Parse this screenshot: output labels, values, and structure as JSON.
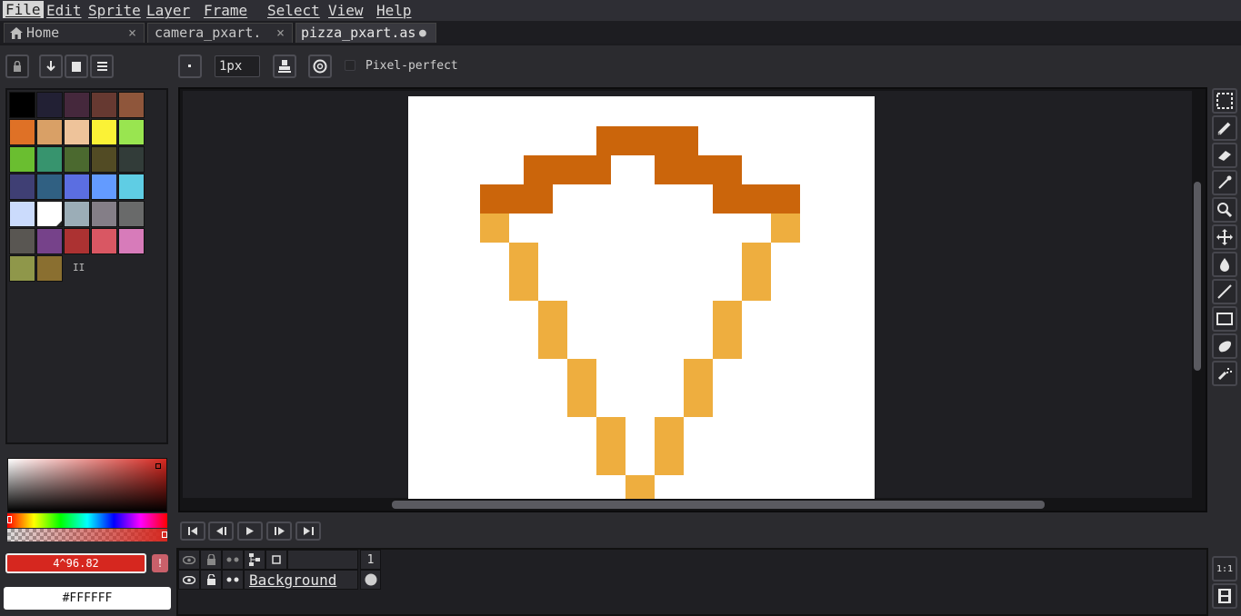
{
  "menu": {
    "items": [
      "File",
      "Edit",
      "Sprite",
      "Layer",
      "Frame",
      "Select",
      "View",
      "Help"
    ]
  },
  "tabs": [
    {
      "label": "Home",
      "icon": "home-icon",
      "close": "×"
    },
    {
      "label": "camera_pxart.",
      "close": "×"
    },
    {
      "label": "pizza_pxart.as",
      "modified_indicator": "●"
    }
  ],
  "toolbar": {
    "brush_size": "1px",
    "pixel_perfect_label": "Pixel-perfect",
    "pixel_perfect_checked": false
  },
  "palette": {
    "colors": [
      "#000000",
      "#222034",
      "#45283c",
      "#663931",
      "#8f563b",
      "#df7126",
      "#d9a066",
      "#eec39a",
      "#fbf236",
      "#99e550",
      "#6abe30",
      "#37946e",
      "#4b692f",
      "#524b24",
      "#323c39",
      "#3f3f74",
      "#306082",
      "#5b6ee1",
      "#639bff",
      "#5fcde4",
      "#cbdbfc",
      "#ffffff",
      "#9badb7",
      "#847e87",
      "#696a6a",
      "#595652",
      "#76428a",
      "#ac3232",
      "#d95763",
      "#d77bba",
      "#8f974a",
      "#8a6f30"
    ],
    "selected_index": 21,
    "resize_handle": "II"
  },
  "color_picker": {
    "foreground_label": "4^96.82",
    "background_label": "#FFFFFF",
    "warning_icon": "exclamation-icon"
  },
  "sprite": {
    "background": "#ffffff",
    "crust_color": "#cb650b",
    "cheese_color": "#eeae3f"
  },
  "timeline": {
    "frame_number": "1",
    "layer_name": "Background"
  },
  "tools": [
    "marquee-icon",
    "pencil-icon",
    "eraser-icon",
    "eyedropper-icon",
    "zoom-icon",
    "move-icon",
    "paint-bucket-icon",
    "line-icon",
    "rectangle-icon",
    "blob-icon",
    "spray-icon"
  ],
  "timeline_zoom_label": "1:1"
}
